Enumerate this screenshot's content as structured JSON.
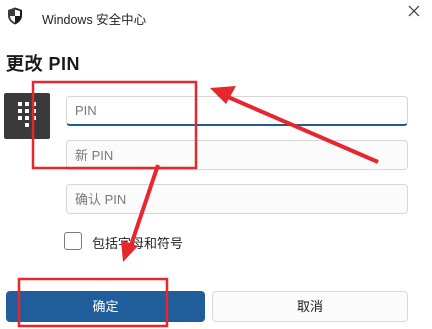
{
  "window": {
    "title": "Windows 安全中心"
  },
  "dialog": {
    "heading": "更改 PIN",
    "fields": {
      "pin_placeholder": "PIN",
      "new_pin_placeholder": "新 PIN",
      "confirm_pin_placeholder": "确认 PIN"
    },
    "checkbox_label": "包括字母和符号",
    "ok_label": "确定",
    "cancel_label": "取消"
  },
  "icons": {
    "app": "shield-icon",
    "close": "close-icon",
    "keypad": "keypad-icon"
  },
  "colors": {
    "accent": "#1f5d9b",
    "annotation_red": "#e8262d"
  }
}
